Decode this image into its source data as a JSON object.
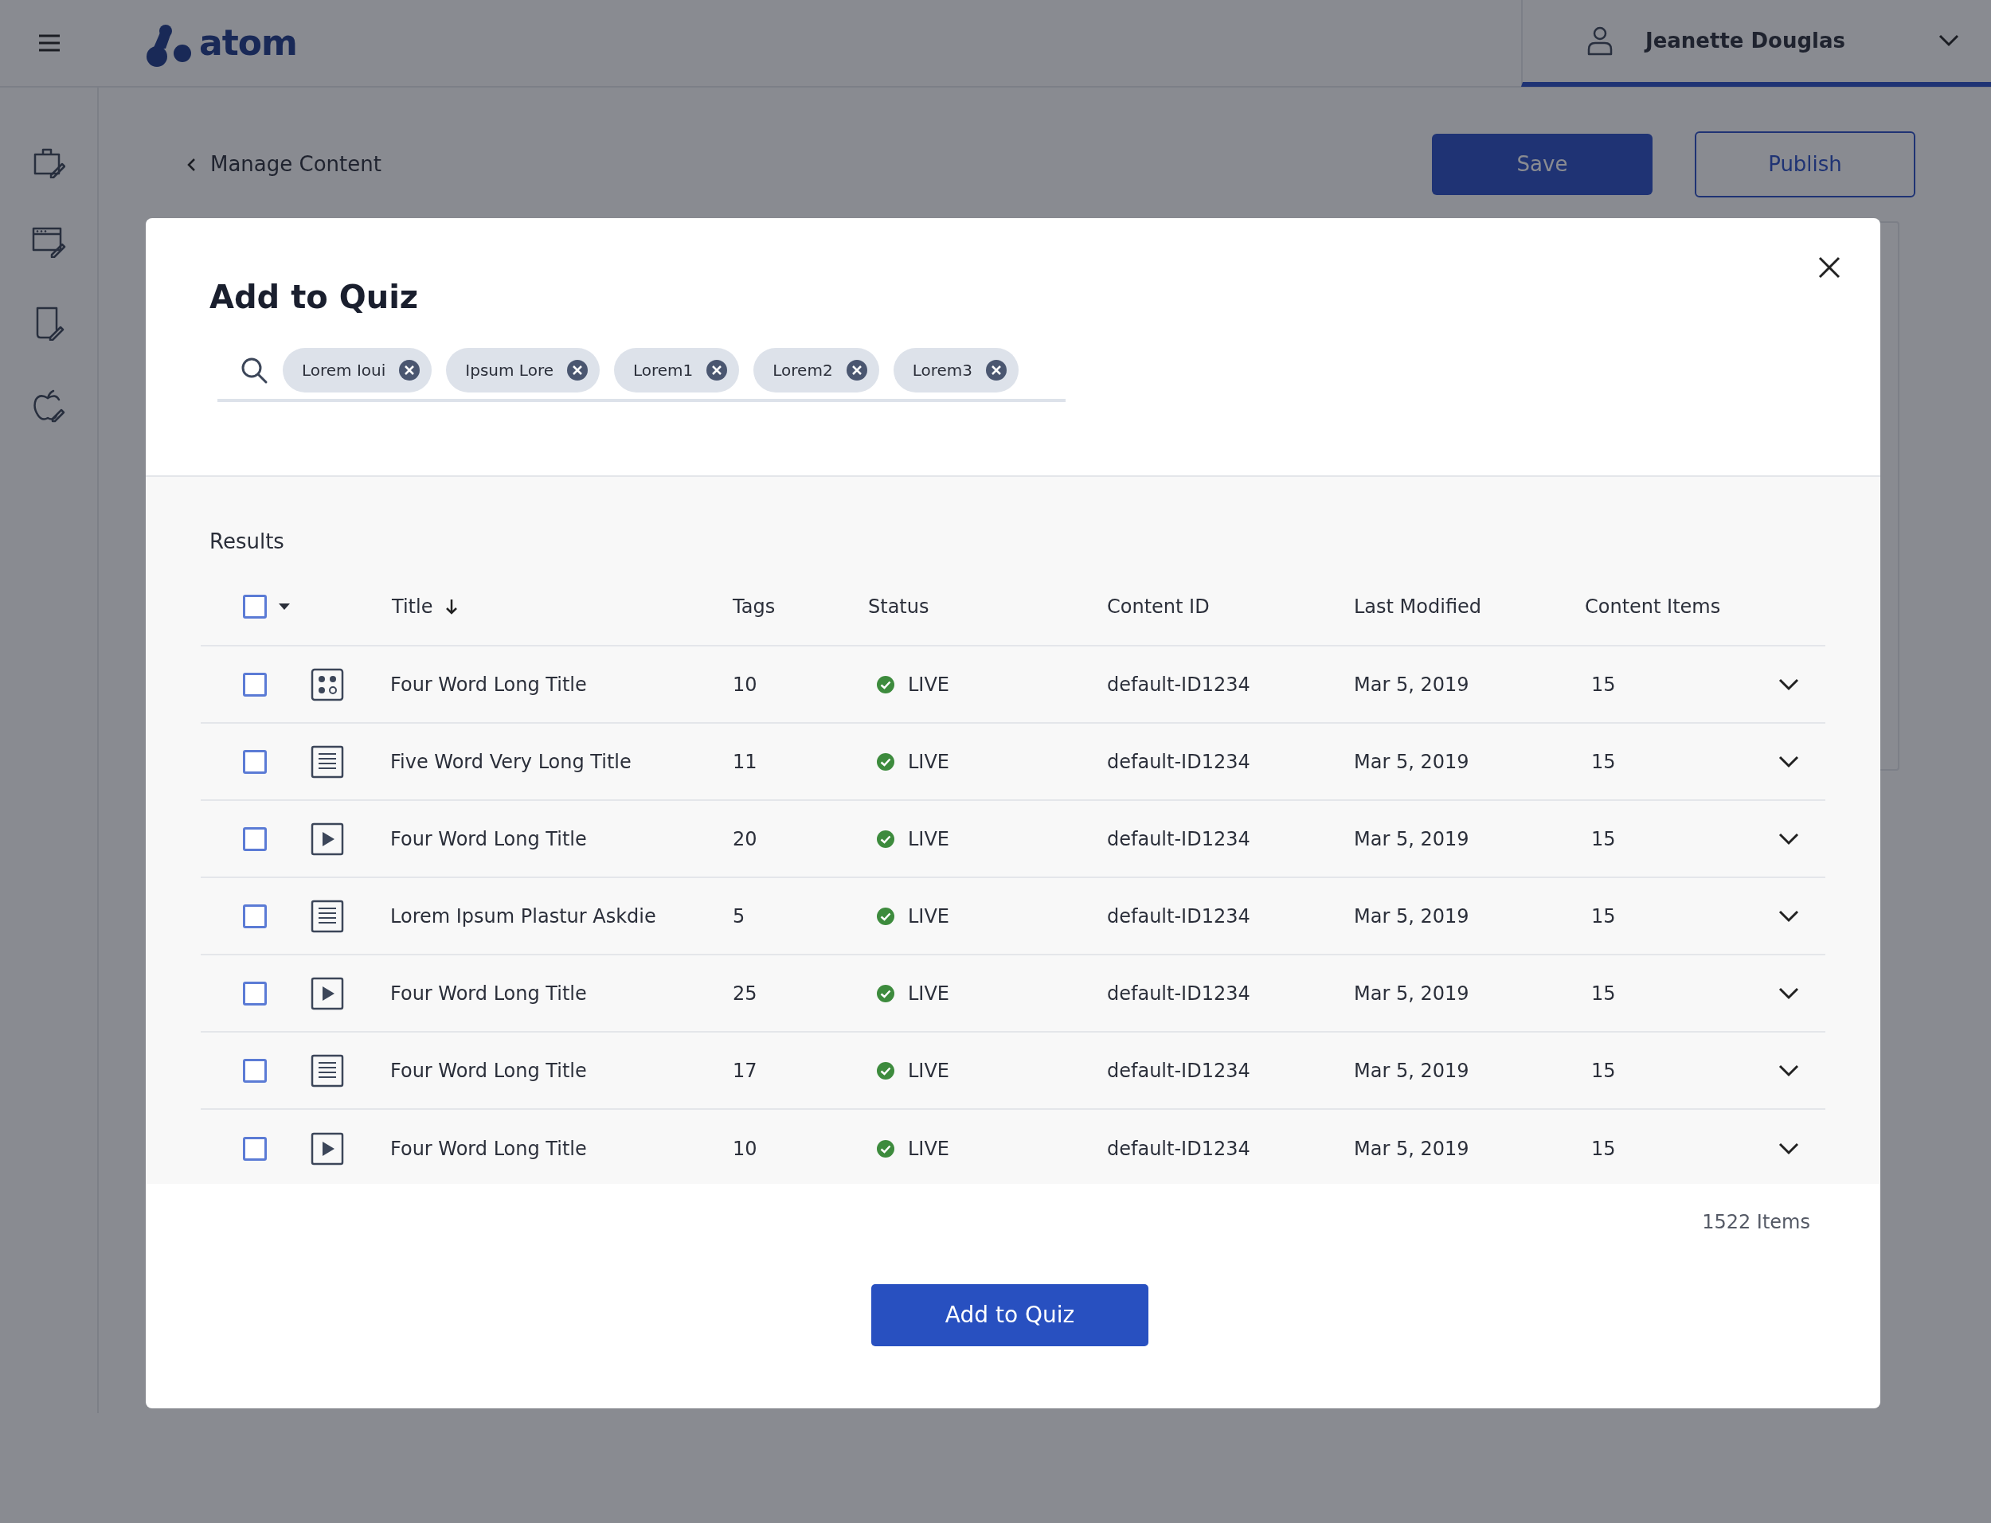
{
  "app": {
    "logo": "atom",
    "user": "Jeanette Douglas"
  },
  "page": {
    "back_link": "Manage Content",
    "buttons": [
      {
        "label": "Save",
        "kind": "primary"
      },
      {
        "label": "Publish",
        "kind": "outline"
      }
    ]
  },
  "modal": {
    "title": "Add to Quiz",
    "search_chips": [
      "Lorem Ioui",
      "Ipsum Lore",
      "Lorem1",
      "Lorem2",
      "Lorem3"
    ],
    "results_label": "Results",
    "select_all": {
      "checked": false
    },
    "columns": [
      {
        "label": "Title",
        "sorted": true
      },
      {
        "label": "Tags",
        "sorted": false
      },
      {
        "label": "Status",
        "sorted": false
      },
      {
        "label": "Content ID",
        "sorted": false
      },
      {
        "label": "Last Modified",
        "sorted": false
      },
      {
        "label": "Content Items",
        "sorted": false
      }
    ],
    "rows": [
      {
        "kind": "quiz",
        "checked": false,
        "title": "Four Word Long Title",
        "tags": "10",
        "status": "LIVE",
        "content_id": "default-ID1234",
        "last_modified": "Mar 5, 2019",
        "content_items": "15"
      },
      {
        "kind": "article",
        "checked": false,
        "title": "Five Word Very Long Title",
        "tags": "11",
        "status": "LIVE",
        "content_id": "default-ID1234",
        "last_modified": "Mar 5, 2019",
        "content_items": "15"
      },
      {
        "kind": "video",
        "checked": false,
        "title": "Four Word Long Title",
        "tags": "20",
        "status": "LIVE",
        "content_id": "default-ID1234",
        "last_modified": "Mar 5, 2019",
        "content_items": "15"
      },
      {
        "kind": "article",
        "checked": false,
        "title": "Lorem Ipsum Plastur Askdie",
        "tags": "5",
        "status": "LIVE",
        "content_id": "default-ID1234",
        "last_modified": "Mar 5, 2019",
        "content_items": "15"
      },
      {
        "kind": "video",
        "checked": false,
        "title": "Four Word Long Title",
        "tags": "25",
        "status": "LIVE",
        "content_id": "default-ID1234",
        "last_modified": "Mar 5, 2019",
        "content_items": "15"
      },
      {
        "kind": "article",
        "checked": false,
        "title": "Four Word Long Title",
        "tags": "17",
        "status": "LIVE",
        "content_id": "default-ID1234",
        "last_modified": "Mar 5, 2019",
        "content_items": "15"
      },
      {
        "kind": "video",
        "checked": false,
        "title": "Four Word Long Title",
        "tags": "10",
        "status": "LIVE",
        "content_id": "default-ID1234",
        "last_modified": "Mar 5, 2019",
        "content_items": "15"
      }
    ],
    "item_count": "1522 Items",
    "submit": "Add to Quiz"
  }
}
